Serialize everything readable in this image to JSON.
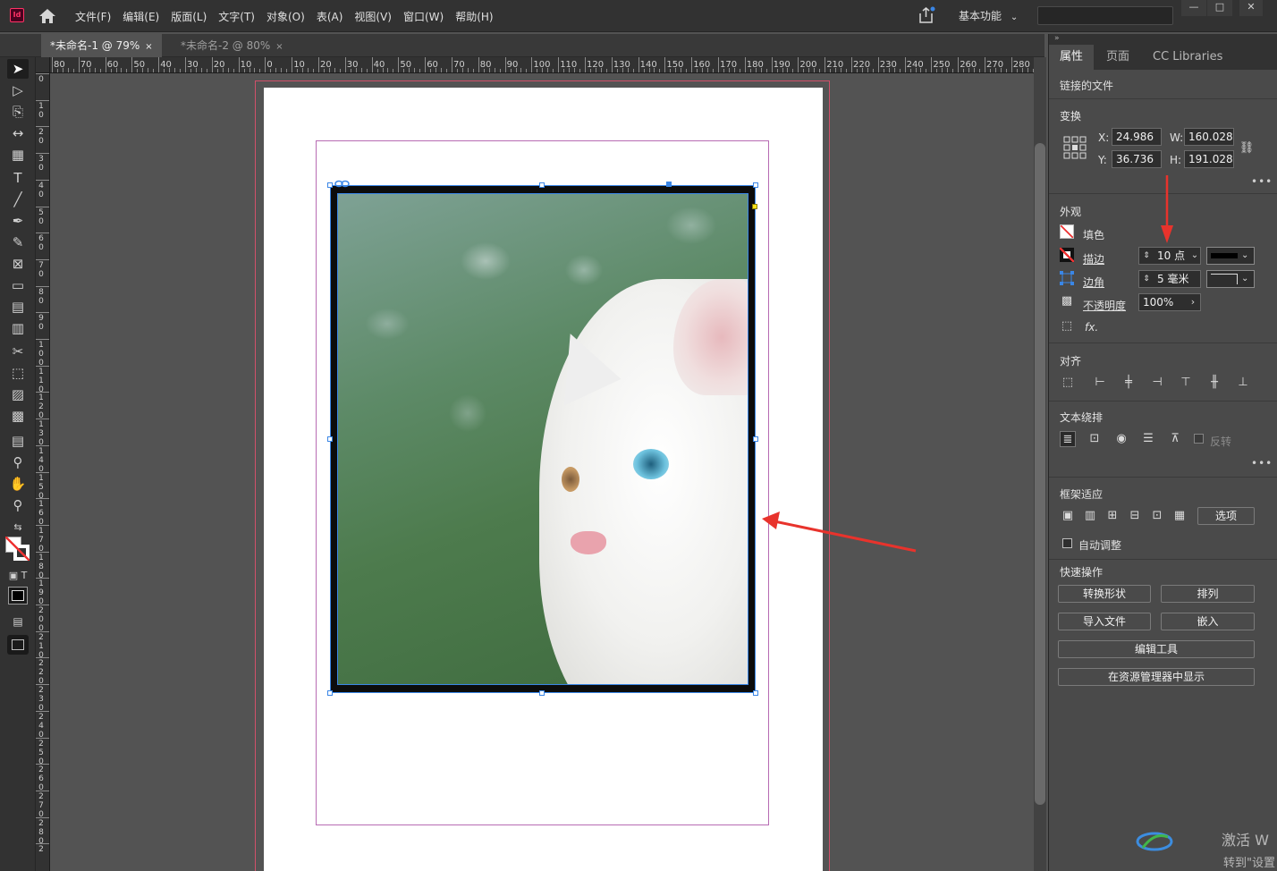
{
  "app": {
    "logo_text": "Id"
  },
  "menu": {
    "items": [
      "文件(F)",
      "编辑(E)",
      "版面(L)",
      "文字(T)",
      "对象(O)",
      "表(A)",
      "视图(V)",
      "窗口(W)",
      "帮助(H)"
    ],
    "workspace": "基本功能",
    "window_buttons": [
      "—",
      "□",
      "✕"
    ]
  },
  "tabs": [
    {
      "label": "*未命名-1 @ 79%",
      "close": "×",
      "active": true
    },
    {
      "label": "*未命名-2 @ 80%",
      "close": "×",
      "active": false
    }
  ],
  "ruler": {
    "h_labels": [
      "80",
      "70",
      "60",
      "50",
      "40",
      "30",
      "20",
      "10",
      "0",
      "10",
      "20",
      "30",
      "40",
      "50",
      "60",
      "70",
      "80",
      "90",
      "100",
      "110",
      "120",
      "130",
      "140",
      "150",
      "160",
      "170",
      "180",
      "190",
      "200",
      "210",
      "220",
      "230",
      "240",
      "250",
      "260",
      "270",
      "280"
    ],
    "v_labels": [
      "0",
      "1 0",
      "2 0",
      "3 0",
      "4 0",
      "5 0",
      "6 0",
      "7 0",
      "8 0",
      "9 0",
      "1 0 0",
      "1 1 0",
      "1 2 0",
      "1 3 0",
      "1 4 0",
      "1 5 0",
      "1 6 0",
      "1 7 0",
      "1 8 0",
      "1 9 0",
      "2 0 0",
      "2 1 0",
      "2 2 0",
      "2 3 0",
      "2 4 0",
      "2 5 0",
      "2 6 0",
      "2 7 0",
      "2 8 0",
      "2"
    ]
  },
  "panel": {
    "tabs": [
      "属性",
      "页面",
      "CC Libraries"
    ],
    "linked_file": "链接的文件",
    "transform": {
      "title": "变换",
      "x_label": "X:",
      "x_value": "24.986",
      "y_label": "Y:",
      "y_value": "36.736",
      "w_label": "W:",
      "w_value": "160.028",
      "h_label": "H:",
      "h_value": "191.028",
      "more": "•••"
    },
    "appearance": {
      "title": "外观",
      "fill_label": "填色",
      "stroke_label": "描边",
      "stroke_value": "10 点",
      "corner_label": "边角",
      "corner_value": "5 毫米",
      "opacity_label": "不透明度",
      "opacity_value": "100%",
      "fx_label": "fx."
    },
    "align": {
      "title": "对齐"
    },
    "text_wrap": {
      "title": "文本绕排",
      "invert_label": "反转",
      "more": "•••"
    },
    "frame_fit": {
      "title": "框架适应",
      "options_button": "选项",
      "auto_fit_label": "自动调整"
    },
    "quick_actions": {
      "title": "快速操作",
      "convert_shape": "转换形状",
      "arrange": "排列",
      "import_file": "导入文件",
      "embed": "嵌入",
      "edit_tool": "编辑工具",
      "show_in_explorer": "在资源管理器中显示"
    }
  },
  "watermark": {
    "line1": "激活 W",
    "line2": "转到\"设置"
  },
  "colors": {
    "accent": "#3a86e6",
    "annotation": "#e8332c",
    "bleed": "#d0506a",
    "margin": "#b76bb3"
  }
}
